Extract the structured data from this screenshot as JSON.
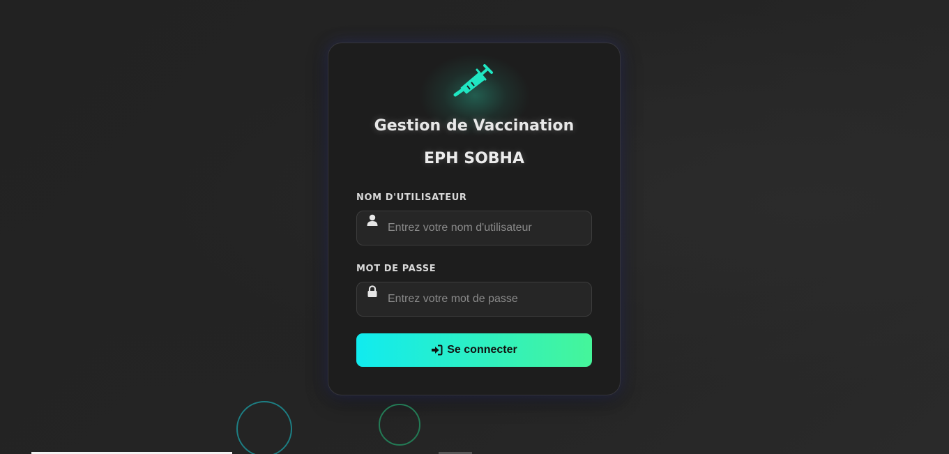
{
  "app": {
    "title": "Gestion de Vaccination",
    "subtitle": "EPH SOBHA",
    "logo_icon": "syringe-icon"
  },
  "form": {
    "username": {
      "label": "NOM D'UTILISATEUR",
      "placeholder": "Entrez votre nom d'utilisateur",
      "value": "",
      "icon": "user-icon"
    },
    "password": {
      "label": "MOT DE PASSE",
      "placeholder": "Entrez votre mot de passe",
      "value": "",
      "icon": "lock-icon"
    },
    "submit": {
      "label": "Se connecter",
      "icon": "sign-in-icon"
    }
  },
  "colors": {
    "accent_start": "#11ebef",
    "accent_end": "#45f59a",
    "background": "#1f1f1f",
    "card": "#1d1d1d"
  }
}
